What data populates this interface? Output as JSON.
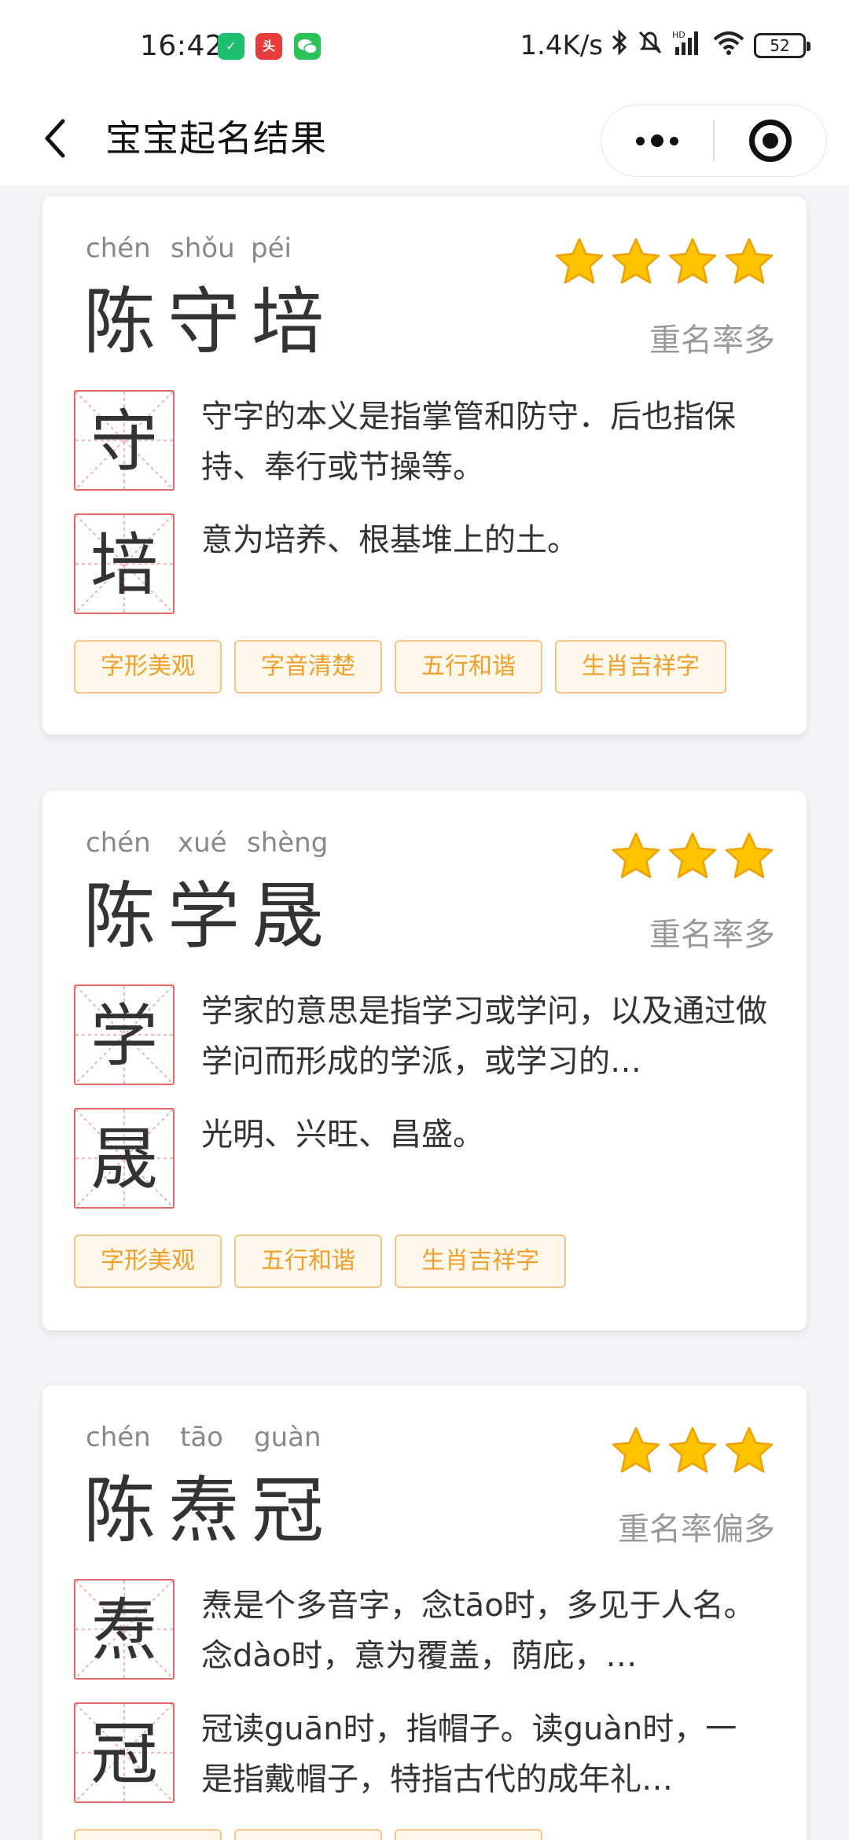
{
  "status_bar": {
    "time": "16:42",
    "app_icons": [
      "vpn-shield-icon",
      "toutiao-icon",
      "wechat-icon"
    ],
    "network_speed": "1.4K/s",
    "battery": "52"
  },
  "nav": {
    "title": "宝宝起名结果"
  },
  "cards": [
    {
      "pinyin": [
        "chén",
        "shǒu",
        "péi"
      ],
      "chars": [
        "陈",
        "守",
        "培"
      ],
      "stars": 4,
      "rate": "重名率多",
      "details": [
        {
          "char": "守",
          "desc": "守字的本义是指掌管和防守．后也指保持、奉行或节操等。"
        },
        {
          "char": "培",
          "desc": "意为培养、根基堆上的土。"
        }
      ],
      "tags": [
        "字形美观",
        "字音清楚",
        "五行和谐",
        "生肖吉祥字"
      ]
    },
    {
      "pinyin": [
        "chén",
        "xué",
        "shèng"
      ],
      "chars": [
        "陈",
        "学",
        "晟"
      ],
      "stars": 3,
      "rate": "重名率多",
      "details": [
        {
          "char": "学",
          "desc": "学家的意思是指学习或学问，以及通过做学问而形成的学派，或学习的…"
        },
        {
          "char": "晟",
          "desc": "光明、兴旺、昌盛。"
        }
      ],
      "tags": [
        "字形美观",
        "五行和谐",
        "生肖吉祥字"
      ]
    },
    {
      "pinyin": [
        "chén",
        "tāo",
        "guàn"
      ],
      "chars": [
        "陈",
        "焘",
        "冠"
      ],
      "stars": 3,
      "rate": "重名率偏多",
      "details": [
        {
          "char": "焘",
          "desc": "焘是个多音字，念tāo时，多见于人名。念dào时，意为覆盖，荫庇，…"
        },
        {
          "char": "冠",
          "desc": "冠读guān时，指帽子。读guàn时，一是指戴帽子，特指古代的成年礼…"
        }
      ],
      "tags": []
    }
  ],
  "colors": {
    "tag_text": "#f0a02a",
    "tag_border": "#f5c48a",
    "tag_bg": "#fff7ea",
    "grid_border": "#e36868",
    "star": "#ffc300",
    "page_bg": "#f3f3f6"
  }
}
